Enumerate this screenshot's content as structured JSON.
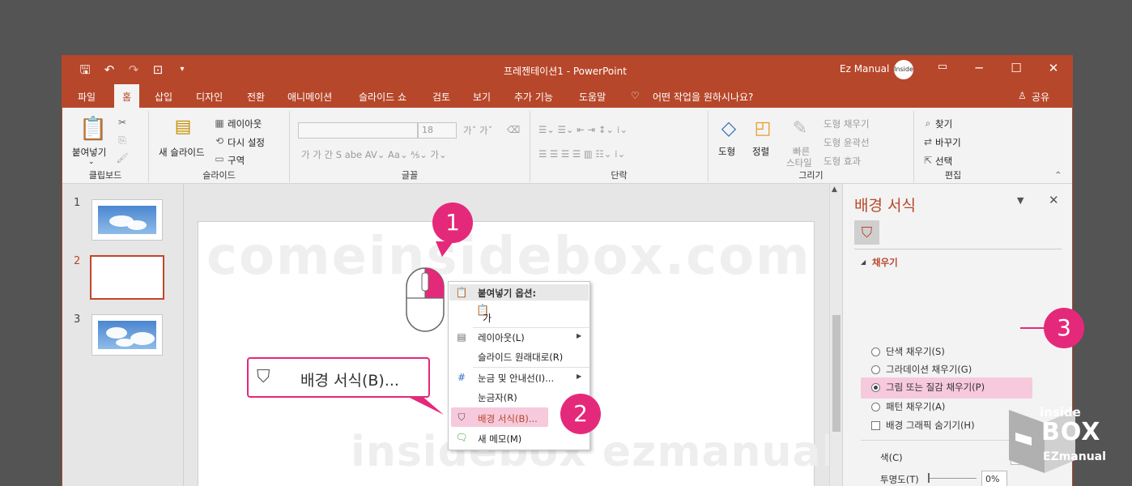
{
  "window": {
    "title": "프레젠테이션1  -  PowerPoint",
    "user": "Ez Manual",
    "avatar_text": "Inside box"
  },
  "qat": {
    "save": "🖫",
    "undo": "↶",
    "redo": "↷",
    "present": "⊡",
    "more": "▾"
  },
  "tabs": [
    "파일",
    "홈",
    "삽입",
    "디자인",
    "전환",
    "애니메이션",
    "슬라이드 쇼",
    "검토",
    "보기",
    "추가 기능",
    "도움말"
  ],
  "active_tab": "홈",
  "tell_me": "어떤 작업을 원하시나요?",
  "share": "공유",
  "ribbon": {
    "clipboard": {
      "label": "클립보드",
      "paste": "붙여넣기"
    },
    "slides": {
      "label": "슬라이드",
      "new_slide": "새 슬라이드",
      "layout": "레이아웃",
      "reset": "다시 설정",
      "section": "구역"
    },
    "font": {
      "label": "글꼴",
      "size": "18"
    },
    "paragraph": {
      "label": "단락"
    },
    "drawing": {
      "label": "그리기",
      "shapes": "도형",
      "arrange": "정렬",
      "quick_styles_1": "빠른",
      "quick_styles_2": "스타일",
      "fill": "도형 채우기",
      "outline": "도형 윤곽선",
      "effects": "도형 효과"
    },
    "editing": {
      "label": "편집",
      "find": "찾기",
      "replace": "바꾸기",
      "select": "선택"
    }
  },
  "thumbnails": [
    "1",
    "2",
    "3"
  ],
  "context_menu": {
    "paste_options": "붙여넣기 옵션:",
    "paste_keep": "가",
    "layout": "레이아웃(L)",
    "reset": "슬라이드 원래대로(R)",
    "grid": "눈금 및 안내선(I)...",
    "ruler": "눈금자(R)",
    "background": "배경 서식(B)...",
    "comment": "새 메모(M)"
  },
  "callout_text": "배경 서식(B)...",
  "badges": [
    "1",
    "2",
    "3"
  ],
  "watermarks": {
    "top": "comeinsidebox.com",
    "bottom": "insidebox ezmanual"
  },
  "pane": {
    "title": "배경 서식",
    "section": "채우기",
    "options": [
      "단색 채우기(S)",
      "그라데이션 채우기(G)",
      "그림 또는 질감 채우기(P)",
      "패턴 채우기(A)"
    ],
    "selected_index": 2,
    "hide_graphics": "배경 그래픽 숨기기(H)",
    "color_label": "색(C)",
    "transparency_label": "투명도(T)",
    "transparency_value": "0%"
  },
  "logo": {
    "line1": "inside",
    "line2": "BOX",
    "line3": "EZmanual"
  },
  "colors": {
    "accent": "#b7472a",
    "badge": "#e5297a",
    "highlight": "#f6c9dc"
  }
}
